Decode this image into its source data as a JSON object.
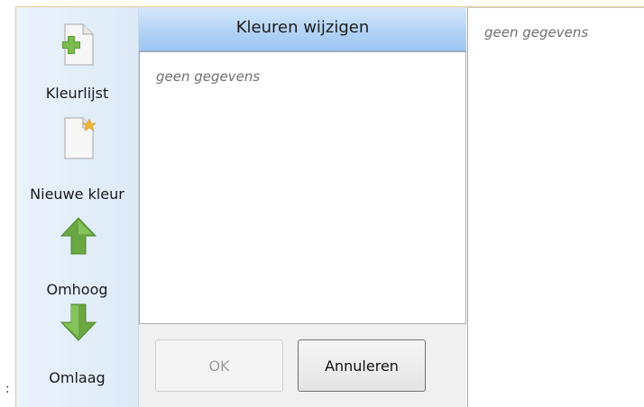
{
  "sidebar": {
    "items": [
      {
        "label": "Kleurlijst",
        "icon": "add-document-icon"
      },
      {
        "label": "Nieuwe kleur",
        "icon": "new-document-star-icon"
      },
      {
        "label": "Omhoog",
        "icon": "arrow-up-icon"
      },
      {
        "label": "Omlaag",
        "icon": "arrow-down-icon"
      }
    ]
  },
  "colors_panel": {
    "title": "Kleuren wijzigen",
    "empty_text": "geen gegevens",
    "ok_label": "OK",
    "cancel_label": "Annuleren"
  },
  "detail_panel": {
    "empty_text": "geen gegevens"
  },
  "corner_mark": ":",
  "colors": {
    "header_gradient_top": "#d6e8fb",
    "header_gradient_bottom": "#9cc6f1",
    "icon_green": "#6aa642",
    "sidebar_bg": "#eaf2fb",
    "accent_border": "#e8c990"
  }
}
